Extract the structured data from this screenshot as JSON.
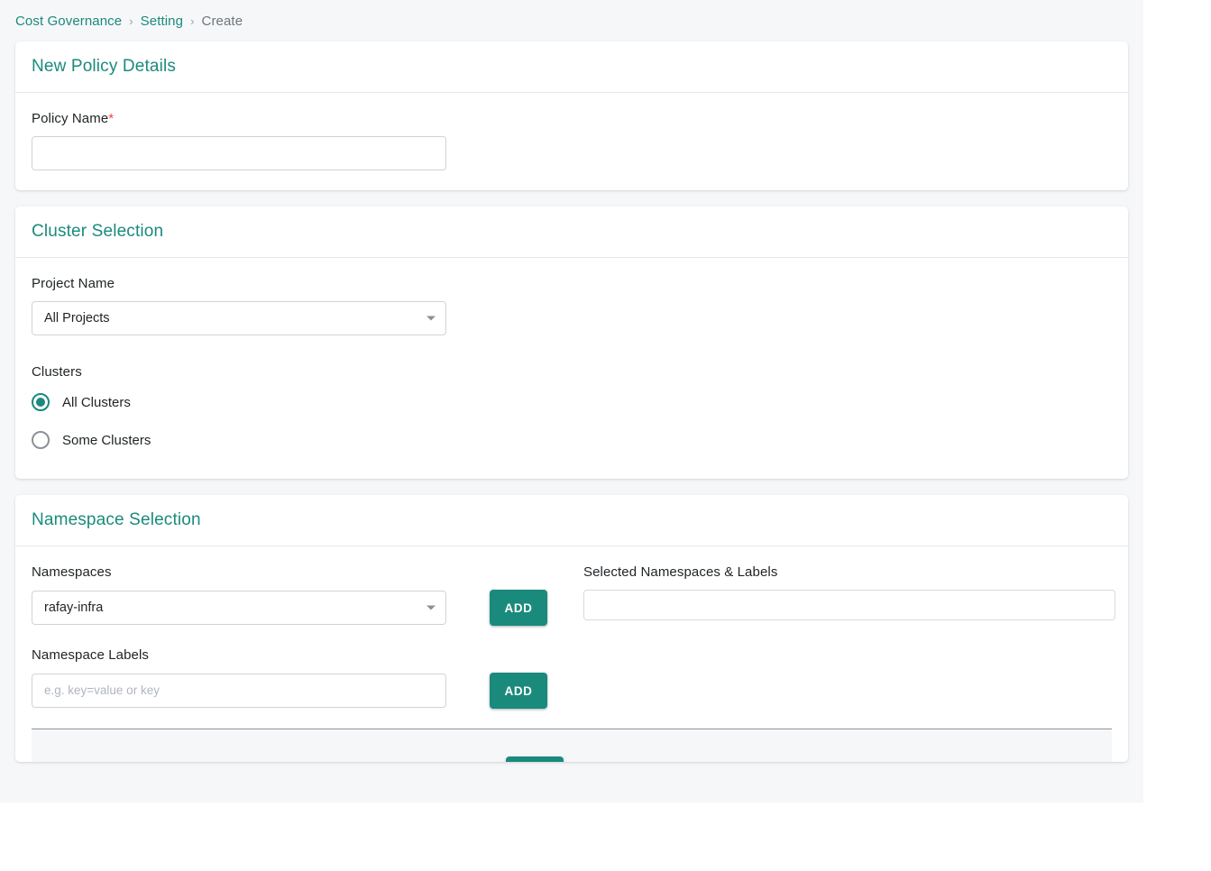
{
  "breadcrumb": {
    "items": [
      {
        "label": "Cost Governance",
        "current": false
      },
      {
        "label": "Setting",
        "current": false
      },
      {
        "label": "Create",
        "current": true
      }
    ],
    "separator": "›"
  },
  "theme": {
    "accent": "#1a8a7d",
    "required_star": "#f4443c",
    "page_background": "#f6f7f9",
    "card_background": "#ffffff",
    "border": "#cfd4d9",
    "text_primary": "#1f2326",
    "text_muted": "#6d757c"
  },
  "policy_details": {
    "title": "New Policy Details",
    "policy_name": {
      "label": "Policy Name",
      "required_marker": "*",
      "value": "",
      "placeholder": ""
    }
  },
  "cluster_selection": {
    "title": "Cluster Selection",
    "project_name": {
      "label": "Project Name",
      "selected": "All Projects",
      "options": [
        "All Projects"
      ]
    },
    "clusters": {
      "label": "Clusters",
      "selected": "All Clusters",
      "options": [
        {
          "label": "All Clusters",
          "checked": true
        },
        {
          "label": "Some Clusters",
          "checked": false
        }
      ]
    }
  },
  "namespace_selection": {
    "title": "Namespace Selection",
    "namespaces": {
      "label": "Namespaces",
      "selected": "rafay-infra",
      "options": [
        "rafay-infra"
      ],
      "add_label": "ADD"
    },
    "namespace_labels": {
      "label": "Namespace Labels",
      "value": "",
      "placeholder": "e.g. key=value or key",
      "add_label": "ADD"
    },
    "selected_namespaces": {
      "label": "Selected Namespaces & Labels",
      "value": ""
    }
  }
}
